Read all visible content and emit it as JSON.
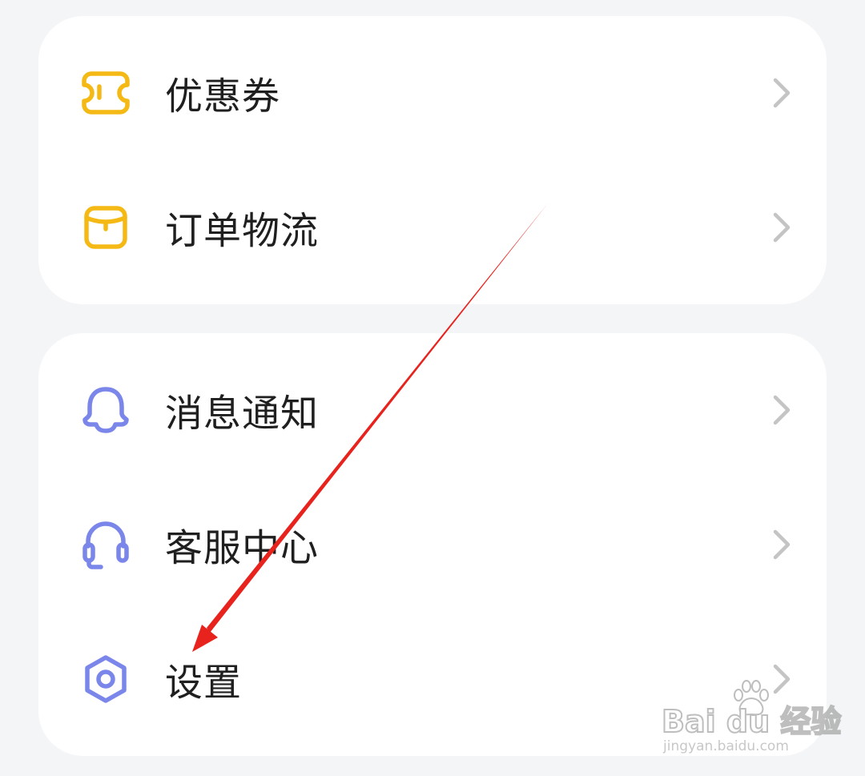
{
  "colors": {
    "background": "#f4f5f7",
    "card": "#ffffff",
    "accent_yellow": "#f5b915",
    "accent_purple": "#7b86ea",
    "chevron": "#c4c4c4",
    "label": "#1f1f1f",
    "annotation_arrow": "#e8221c"
  },
  "cards": [
    {
      "items": [
        {
          "label": "优惠券",
          "icon": "coupon-icon"
        },
        {
          "label": "订单物流",
          "icon": "package-icon"
        }
      ]
    },
    {
      "items": [
        {
          "label": "消息通知",
          "icon": "bell-icon"
        },
        {
          "label": "客服中心",
          "icon": "headset-icon"
        },
        {
          "label": "设置",
          "icon": "settings-hexagon-icon"
        }
      ]
    }
  ],
  "chevron_icon": "chevron-right-icon",
  "watermark": {
    "logo": "Bai du 经验",
    "url": "jingyan.baidu.com"
  }
}
